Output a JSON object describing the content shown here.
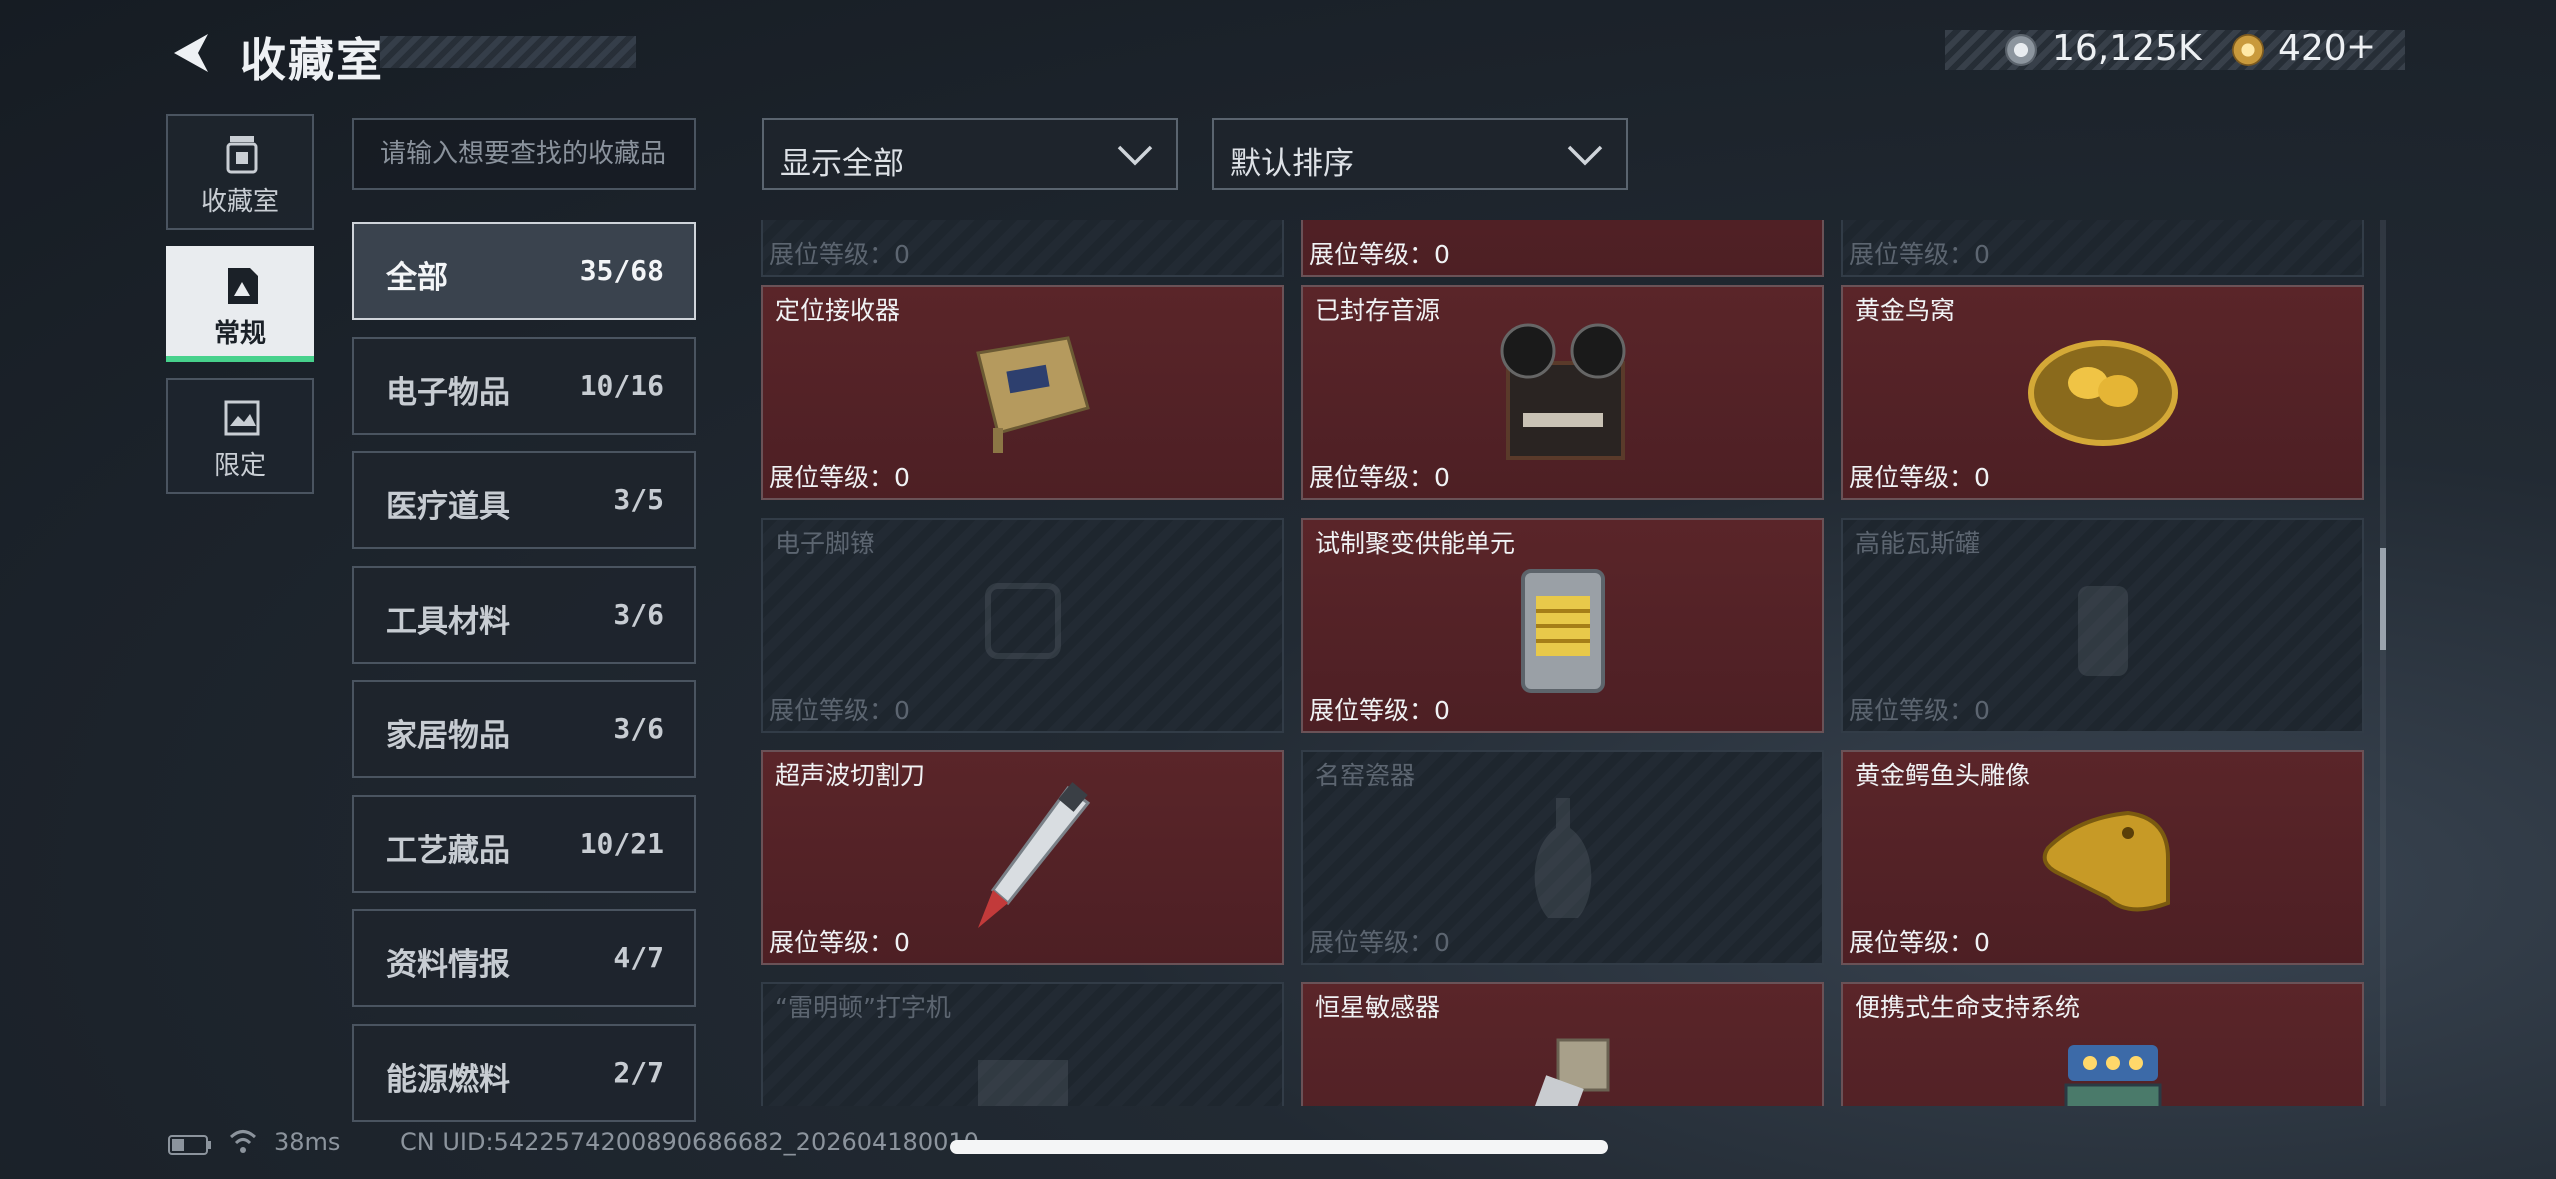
{
  "header": {
    "title": "收藏室"
  },
  "currency": {
    "silver_value": "16,125K",
    "gold_value": "420",
    "gold_plus": "+"
  },
  "left_nav": [
    {
      "label": "收藏室",
      "icon": "trash-box-icon"
    },
    {
      "label": "常规",
      "icon": "document-triangle-icon",
      "active": true
    },
    {
      "label": "限定",
      "icon": "landscape-frame-icon"
    }
  ],
  "search": {
    "placeholder": "请输入想要查找的收藏品"
  },
  "categories": [
    {
      "name": "全部",
      "count": "35/68",
      "active": true
    },
    {
      "name": "电子物品",
      "count": "10/16"
    },
    {
      "name": "医疗道具",
      "count": "3/5"
    },
    {
      "name": "工具材料",
      "count": "3/6"
    },
    {
      "name": "家居物品",
      "count": "3/6"
    },
    {
      "name": "工艺藏品",
      "count": "10/21"
    },
    {
      "name": "资料情报",
      "count": "4/7"
    },
    {
      "name": "能源燃料",
      "count": "2/7"
    }
  ],
  "filters": {
    "filter_value": "显示全部",
    "sort_value": "默认排序"
  },
  "level_label": "展位等级：0",
  "items": [
    {
      "name": "",
      "owned": false
    },
    {
      "name": "",
      "owned": true
    },
    {
      "name": "",
      "owned": false
    },
    {
      "name": "定位接收器",
      "owned": true
    },
    {
      "name": "已封存音源",
      "owned": true
    },
    {
      "name": "黄金鸟窝",
      "owned": true
    },
    {
      "name": "电子脚镣",
      "owned": false
    },
    {
      "name": "试制聚变供能单元",
      "owned": true
    },
    {
      "name": "高能瓦斯罐",
      "owned": false
    },
    {
      "name": "超声波切割刀",
      "owned": true
    },
    {
      "name": "名窑瓷器",
      "owned": false
    },
    {
      "name": "黄金鳄鱼头雕像",
      "owned": true
    },
    {
      "name": "“雷明顿”打字机",
      "owned": false
    },
    {
      "name": "恒星敏感器",
      "owned": true
    },
    {
      "name": "便携式生命支持系统",
      "owned": true
    }
  ],
  "footer": {
    "ping": "38ms",
    "uid": "CN UID:542257420089068668​2_202604180010"
  }
}
